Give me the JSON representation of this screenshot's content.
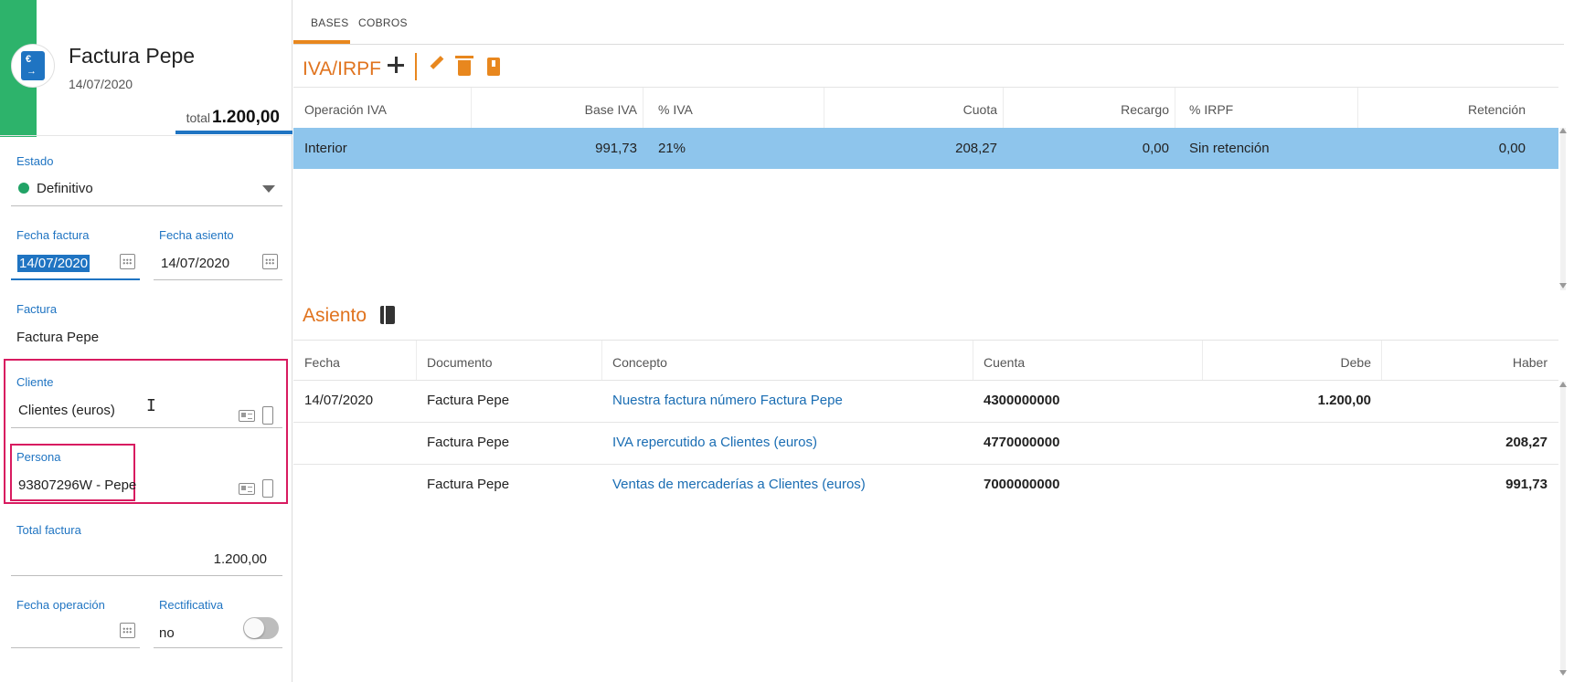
{
  "invoice": {
    "title": "Factura Pepe",
    "date": "14/07/2020",
    "total_label": "total",
    "total_value": "1.200,00"
  },
  "form": {
    "estado": {
      "label": "Estado",
      "value": "Definitivo"
    },
    "fecha_factura": {
      "label": "Fecha factura",
      "value": "14/07/2020"
    },
    "fecha_asiento": {
      "label": "Fecha asiento",
      "value": "14/07/2020"
    },
    "factura": {
      "label": "Factura",
      "value": "Factura Pepe"
    },
    "cliente": {
      "label": "Cliente",
      "value": "Clientes (euros)"
    },
    "persona": {
      "label": "Persona",
      "value": "93807296W - Pepe"
    },
    "total_factura": {
      "label": "Total factura",
      "value": "1.200,00"
    },
    "fecha_operacion": {
      "label": "Fecha operación",
      "value": ""
    },
    "rectificativa": {
      "label": "Rectificativa",
      "value": "no"
    }
  },
  "tabs": [
    {
      "label": "BASES",
      "active": true
    },
    {
      "label": "COBROS",
      "active": false
    }
  ],
  "iva": {
    "title": "IVA/IRPF",
    "columns": [
      "Operación IVA",
      "Base IVA",
      "% IVA",
      "Cuota",
      "Recargo",
      "% IRPF",
      "Retención"
    ],
    "rows": [
      {
        "operacion": "Interior",
        "base": "991,73",
        "pct_iva": "21%",
        "cuota": "208,27",
        "recargo": "0,00",
        "pct_irpf": "Sin retención",
        "retencion": "0,00"
      }
    ]
  },
  "asiento": {
    "title": "Asiento",
    "columns": [
      "Fecha",
      "Documento",
      "Concepto",
      "Cuenta",
      "Debe",
      "Haber"
    ],
    "rows": [
      {
        "fecha": "14/07/2020",
        "documento": "Factura Pepe",
        "concepto": "Nuestra factura número Factura Pepe",
        "cuenta": "4300000000",
        "debe": "1.200,00",
        "haber": ""
      },
      {
        "fecha": "",
        "documento": "Factura Pepe",
        "concepto": "IVA repercutido a Clientes (euros)",
        "cuenta": "4770000000",
        "debe": "",
        "haber": "208,27"
      },
      {
        "fecha": "",
        "documento": "Factura Pepe",
        "concepto": "Ventas de mercaderías a Clientes (euros)",
        "cuenta": "7000000000",
        "debe": "",
        "haber": "991,73"
      }
    ]
  },
  "colors": {
    "brand_green": "#2db36b",
    "accent_blue": "#1f74c2",
    "accent_orange": "#e8871e",
    "highlight_magenta": "#d81b60",
    "selected_row": "#8ec5ec"
  }
}
